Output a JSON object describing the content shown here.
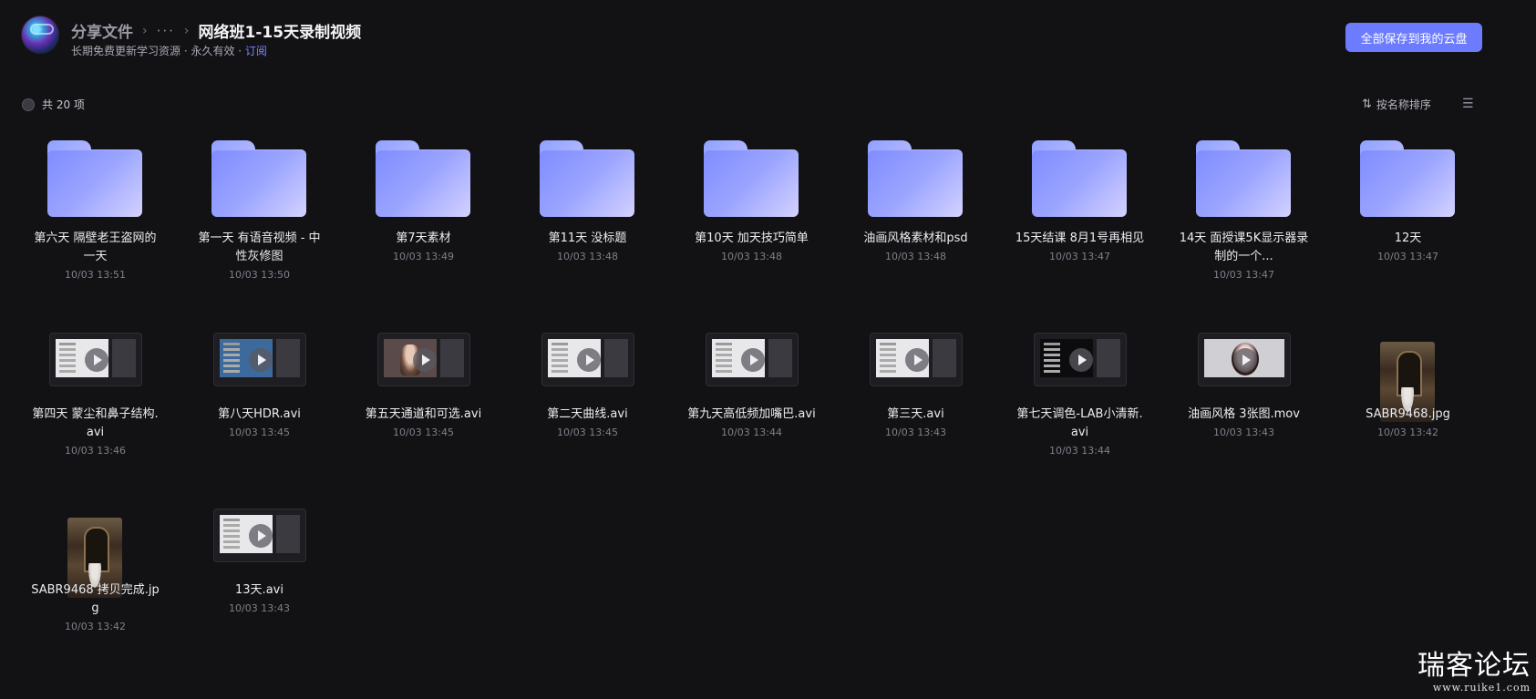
{
  "header": {
    "breadcrumb_root": "分享文件",
    "breadcrumb_more": "···",
    "breadcrumb_current": "网络班1-15天录制视频",
    "subtitle_text": "长期免费更新学习资源 · 永久有效 · ",
    "subtitle_link": "订阅",
    "save_button": "全部保存到我的云盘"
  },
  "toolbar": {
    "count_label": "共 20 项",
    "sort_label": "按名称排序"
  },
  "items": [
    {
      "type": "folder",
      "name": "第六天 隔壁老王盗网的一天",
      "date": "10/03 13:51"
    },
    {
      "type": "folder",
      "name": "第一天 有语音视频 - 中性灰修图",
      "date": "10/03 13:50"
    },
    {
      "type": "folder",
      "name": "第7天素材",
      "date": "10/03 13:49"
    },
    {
      "type": "folder",
      "name": "第11天 没标题",
      "date": "10/03 13:48"
    },
    {
      "type": "folder",
      "name": "第10天 加天技巧简单",
      "date": "10/03 13:48"
    },
    {
      "type": "folder",
      "name": "油画风格素材和psd",
      "date": "10/03 13:48"
    },
    {
      "type": "folder",
      "name": "15天结课 8月1号再相见",
      "date": "10/03 13:47"
    },
    {
      "type": "folder",
      "name": "14天 面授课5K显示器录制的一个...",
      "date": "10/03 13:47"
    },
    {
      "type": "folder",
      "name": "12天",
      "date": "10/03 13:47"
    },
    {
      "type": "video",
      "name": "第四天 蒙尘和鼻子结构.avi",
      "date": "10/03 13:46"
    },
    {
      "type": "video",
      "name": "第八天HDR.avi",
      "date": "10/03 13:45"
    },
    {
      "type": "video",
      "name": "第五天通道和可选.avi",
      "date": "10/03 13:45"
    },
    {
      "type": "video",
      "name": "第二天曲线.avi",
      "date": "10/03 13:45"
    },
    {
      "type": "video",
      "name": "第九天高低频加嘴巴.avi",
      "date": "10/03 13:44"
    },
    {
      "type": "video",
      "name": "第三天.avi",
      "date": "10/03 13:43"
    },
    {
      "type": "video",
      "name": "第七天调色-LAB小清新.avi",
      "date": "10/03 13:44"
    },
    {
      "type": "video",
      "name": "油画风格 3张图.mov",
      "date": "10/03 13:43"
    },
    {
      "type": "image",
      "name": "SABR9468.jpg",
      "date": "10/03 13:42"
    },
    {
      "type": "image",
      "name": "SABR9468 拷贝完成.jpg",
      "date": "10/03 13:42"
    },
    {
      "type": "video",
      "name": "13天.avi",
      "date": "10/03 13:43"
    }
  ],
  "watermark": {
    "title": "瑞客论坛",
    "url": "www.ruike1.com"
  },
  "colors": {
    "background": "#121215",
    "accent": "#6d7cff",
    "folder": "#8b96ff"
  }
}
